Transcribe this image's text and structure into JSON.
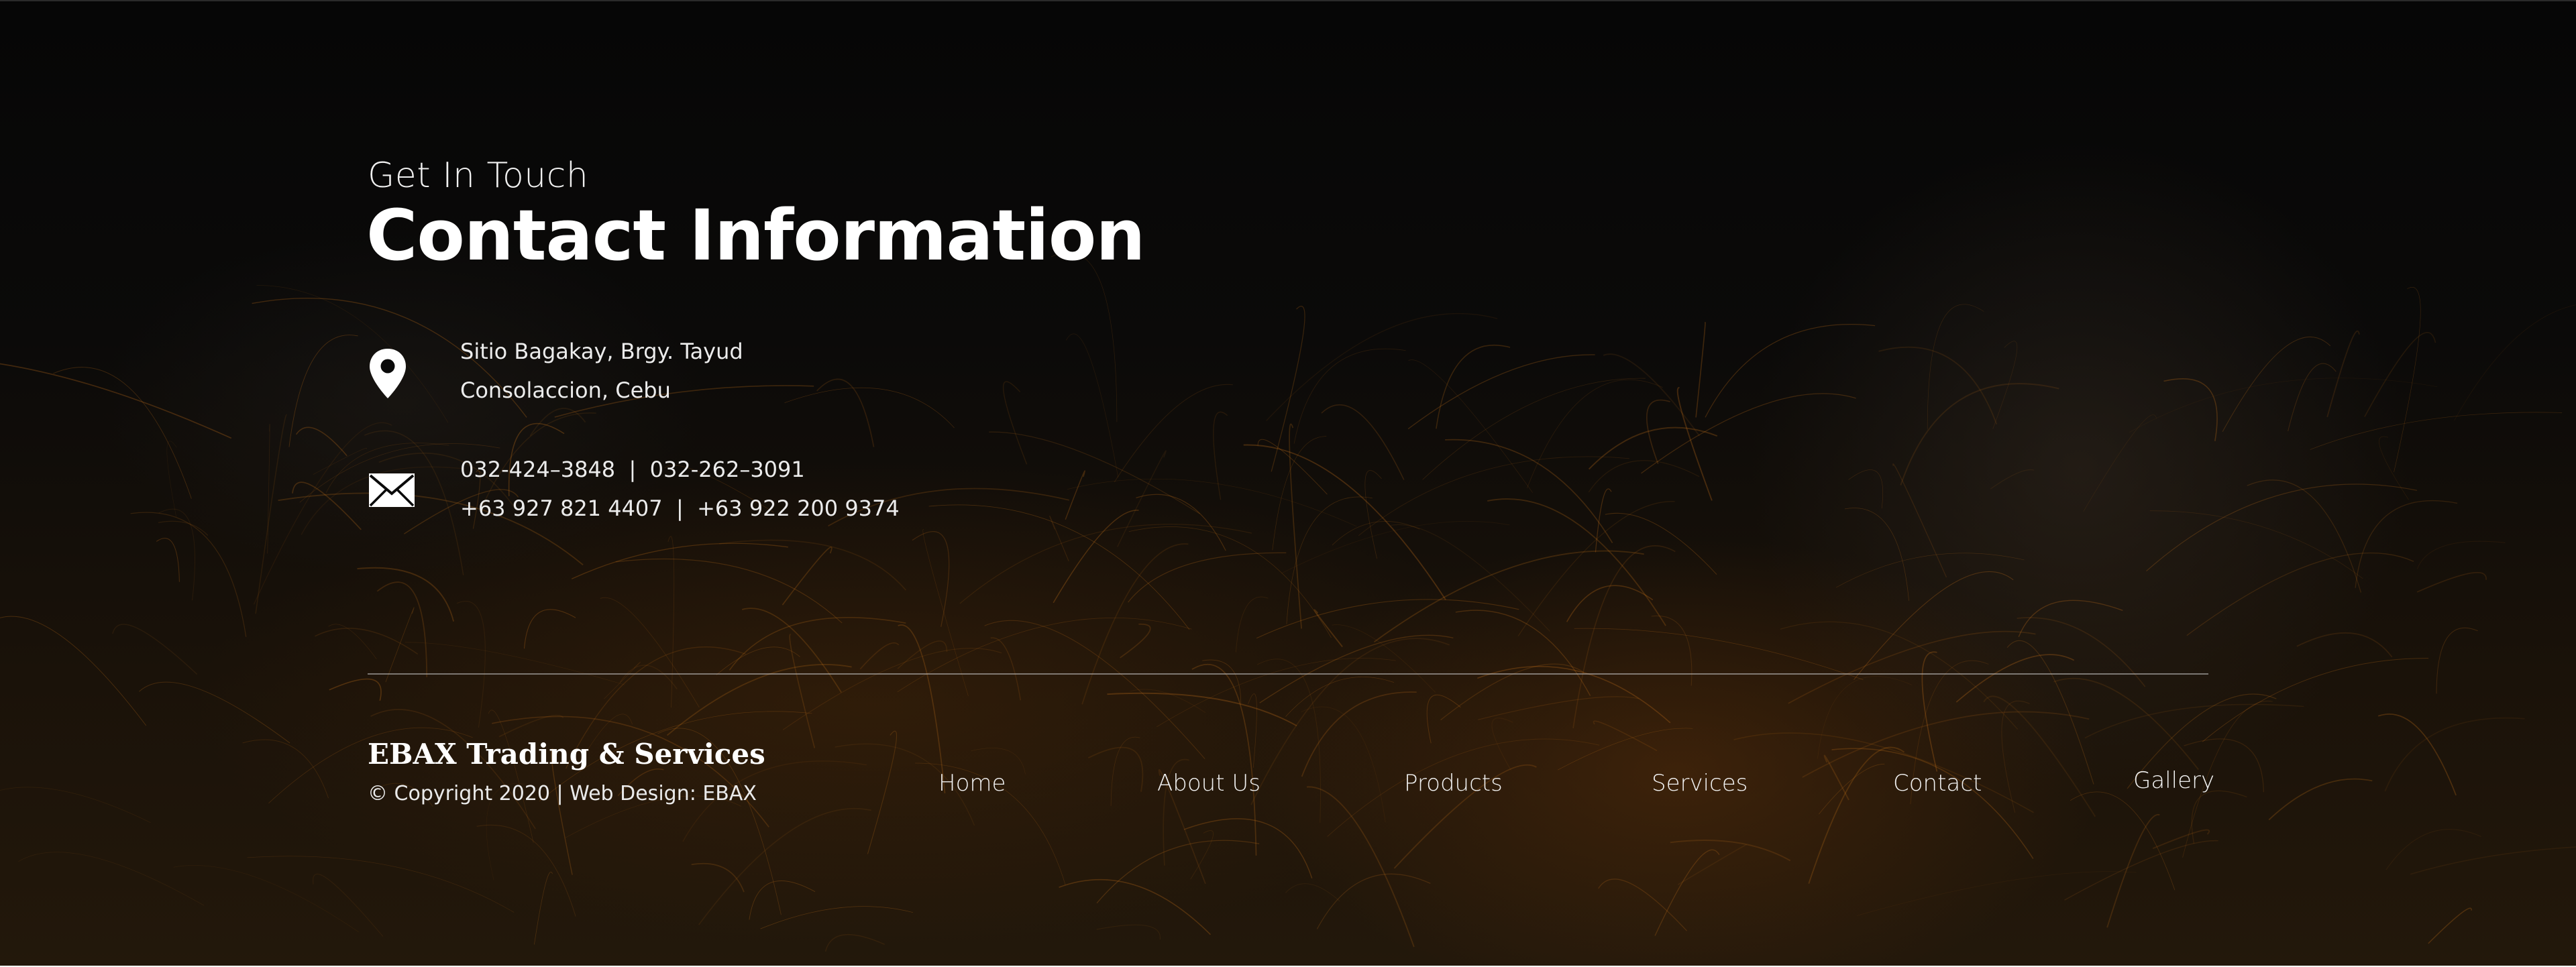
{
  "contact_section": {
    "subtitle": "Get In Touch",
    "title": "Contact Information",
    "address": {
      "icon": "map-pin-icon",
      "line1": "Sitio Bagakay, Brgy. Tayud",
      "line2": "Consolaccion, Cebu"
    },
    "phones": {
      "icon": "envelope-icon",
      "line1": "032-424–3848  |  032-262–3091",
      "line2": "+63 927 821 4407  |  +63 922 200 9374"
    }
  },
  "footer": {
    "brand": "EBAX Trading & Services",
    "copyright": "© Copyright 2020 | Web Design: EBAX",
    "nav": [
      {
        "label": "Home"
      },
      {
        "label": "About Us"
      },
      {
        "label": "Products"
      },
      {
        "label": "Services"
      },
      {
        "label": "Contact"
      },
      {
        "label": "Gallery"
      }
    ]
  },
  "colors": {
    "background": "#000000",
    "text": "#ffffff",
    "spark_accent": "#c8731a"
  }
}
